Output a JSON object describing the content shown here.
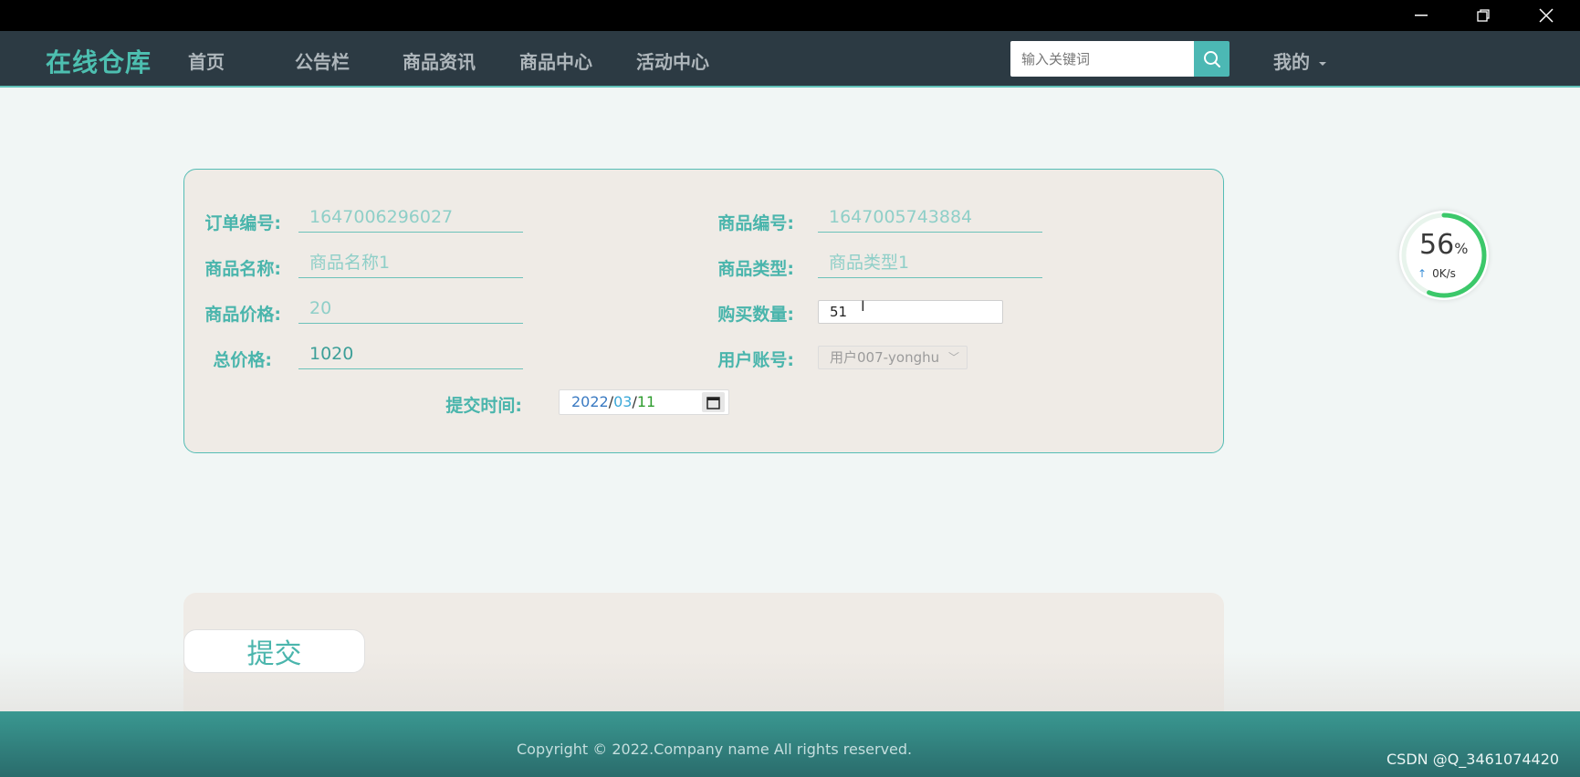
{
  "window": {
    "min_icon": "minimize-icon",
    "max_icon": "restore-icon",
    "close_icon": "close-icon"
  },
  "nav": {
    "brand": "在线仓库",
    "items": [
      "首页",
      "公告栏",
      "商品资讯",
      "商品中心",
      "活动中心"
    ],
    "search_placeholder": "输入关键词",
    "search_icon": "search-icon",
    "mine_label": "我的"
  },
  "form": {
    "order_no_label": "订单编号:",
    "order_no_value": "1647006296027",
    "goods_no_label": "商品编号:",
    "goods_no_value": "1647005743884",
    "goods_name_label": "商品名称:",
    "goods_name_value": "商品名称1",
    "goods_type_label": "商品类型:",
    "goods_type_value": "商品类型1",
    "price_label": "商品价格:",
    "price_value": "20",
    "qty_label": "购买数量:",
    "qty_value": "51",
    "total_label": "总价格:",
    "total_value": "1020",
    "account_label": "用户账号:",
    "account_value": "用户007-yonghu",
    "submit_time_label": "提交时间:",
    "date_year": "2022",
    "date_month": "03",
    "date_day": "11"
  },
  "submit_label": "提交",
  "footer": {
    "copyright": "Copyright © 2022.Company name All rights reserved.",
    "watermark": "CSDN @Q_3461074420"
  },
  "speed_widget": {
    "percent": "56",
    "percent_unit": "%",
    "rate": "0K/s"
  },
  "colors": {
    "accent": "#4ab5ac",
    "navbar_bg": "#2c3a43",
    "footer_bg": "#3a9891"
  }
}
